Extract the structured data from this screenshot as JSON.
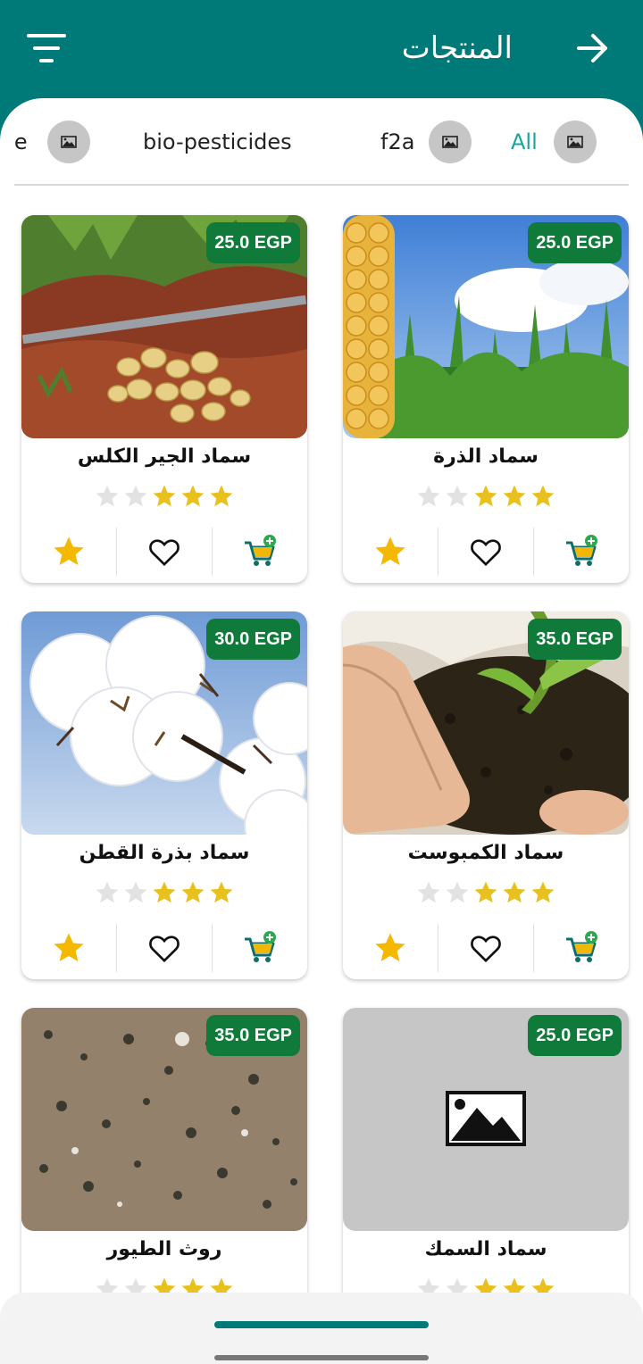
{
  "header": {
    "title": "المنتجات",
    "filter_icon": "filter-icon",
    "back_icon": "arrow-forward-icon"
  },
  "categories": [
    {
      "label": "All",
      "active": true
    },
    {
      "label": "f2a",
      "active": false
    },
    {
      "label": "bio-pesticides",
      "active": false
    },
    {
      "label": "ble",
      "active": false
    }
  ],
  "products": [
    {
      "name": "سماد الذرة",
      "price": "25.0 EGP",
      "rating": 3,
      "image": "corn-field"
    },
    {
      "name": "سماد الجير الكلس",
      "price": "25.0 EGP",
      "rating": 3,
      "image": "potatoes-in-soil"
    },
    {
      "name": "سماد الكمبوست",
      "price": "35.0 EGP",
      "rating": 3,
      "image": "hands-with-compost"
    },
    {
      "name": "سماد بذرة القطن",
      "price": "30.0 EGP",
      "rating": 3,
      "image": "cotton-bolls"
    },
    {
      "name": "سماد السمك",
      "price": "25.0 EGP",
      "rating": 3,
      "image": "image-placeholder"
    },
    {
      "name": "روث الطيور",
      "price": "35.0 EGP",
      "rating": 3,
      "image": "poultry-manure"
    }
  ],
  "theme": {
    "primary": "#007a78",
    "price_badge": "#0f7a3a",
    "star_active": "#e8c11e",
    "star_inactive": "#e2e2e2",
    "fav_star": "#f5b800"
  }
}
